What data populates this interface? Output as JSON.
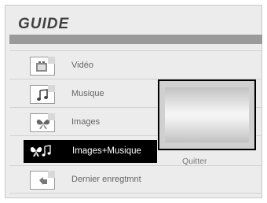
{
  "title": "GUIDE",
  "menu": [
    {
      "label": "Vidéo",
      "icon": "video-file-icon",
      "selected": false
    },
    {
      "label": "Musique",
      "icon": "music-note-icon",
      "selected": false
    },
    {
      "label": "Images",
      "icon": "butterfly-image-icon",
      "selected": false
    },
    {
      "label": "Images+Musique",
      "icon": "butterfly-music-icon",
      "selected": true
    },
    {
      "label": "Dernier enregtmnt",
      "icon": "last-record-icon",
      "selected": false
    }
  ],
  "quit_label": "Quitter",
  "colors": {
    "background": "#ececec",
    "title_bar": "#9a9a9a",
    "selected_bg": "#000000",
    "selected_text": "#ffffff",
    "text": "#666666"
  }
}
